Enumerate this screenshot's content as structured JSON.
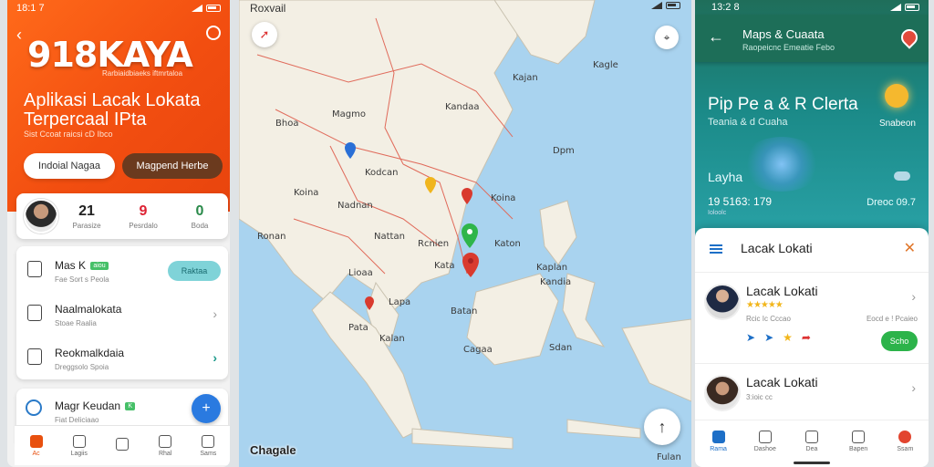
{
  "left": {
    "status_time": "18:1 7",
    "brand": "918KAYA",
    "brand_sub": "Rarbiaidbiaeks iftmrtaloa",
    "title": "Aplikasi Lacak Lokata Terpercaal IPta",
    "small": "Sist Ccoat raicsi cD Ibco",
    "btn_primary": "Indoial Nagaa",
    "btn_secondary": "Magpend Herbe",
    "stats": [
      {
        "value": "21",
        "label": "Parasize"
      },
      {
        "value": "9",
        "label": "Pesrdalo"
      },
      {
        "value": "0",
        "label": "Boda"
      }
    ],
    "list": [
      {
        "title": "Mas K",
        "tag": "aiou",
        "sub": "Fae Sort s Peola",
        "pill": "Raktaa"
      },
      {
        "title": "Naalmalokata",
        "sub": "Stoae Raalia"
      },
      {
        "title": "Reokmalkdaia",
        "sub": "Dreggsolo Spoia"
      }
    ],
    "card2": {
      "title": "Magr Keudan",
      "tag": "K",
      "sub": "Fiat Deliciaao"
    },
    "nav": [
      "Ac",
      "Lagiis",
      "",
      "Rhal",
      "Sams"
    ]
  },
  "map": {
    "title": "Roxvail",
    "logo": "Chagale",
    "labels": [
      {
        "text": "Kajan",
        "cls": "l1"
      },
      {
        "text": "Kagle",
        "cls": "l2"
      },
      {
        "text": "Bhoa",
        "cls": "l3"
      },
      {
        "text": "Magmo",
        "cls": "l4"
      },
      {
        "text": "Kandaa",
        "cls": "l5"
      },
      {
        "text": "Koina",
        "cls": "l6"
      },
      {
        "text": "Dpm",
        "cls": "l7"
      },
      {
        "text": "Kodcan",
        "cls": "l8"
      },
      {
        "text": "Koina",
        "cls": "l9"
      },
      {
        "text": "Nadnan",
        "cls": "l10"
      },
      {
        "text": "Nattan",
        "cls": "l11"
      },
      {
        "text": "Ronan",
        "cls": "l12"
      },
      {
        "text": "Rcnien",
        "cls": "l13"
      },
      {
        "text": "Katon",
        "cls": "l14"
      },
      {
        "text": "Kaplan",
        "cls": "l15"
      },
      {
        "text": "Lioaa",
        "cls": "l16"
      },
      {
        "text": "Kata",
        "cls": "l17"
      },
      {
        "text": "Pata",
        "cls": "l18"
      },
      {
        "text": "Batan",
        "cls": "l19"
      },
      {
        "text": "Cagaa",
        "cls": "l20"
      },
      {
        "text": "Kalan",
        "cls": "l21"
      },
      {
        "text": "Kandia",
        "cls": "l22"
      },
      {
        "text": "Lapa",
        "cls": "l23"
      },
      {
        "text": "Fulan",
        "cls": "l24"
      },
      {
        "text": "Sdan",
        "cls": "l25"
      }
    ]
  },
  "right": {
    "status_time": "13:2 8",
    "topbar_title": "Maps & Cuaata",
    "topbar_sub": "Raopeicnc Emeatie Febo",
    "hero_title": "Pip Pe a & R Clerta",
    "hero_sub": "Teania & d Cuaha",
    "sun_label": "Snabeon",
    "layer": "Layha",
    "coord1": "19 5163: 179",
    "coord1_sub": "Ioloolc",
    "coord2": "Dreoc 09.7",
    "sheet_title": "Lacak Lokati",
    "item1_name": "Lacak Lokati",
    "item1_stars": "★★★★★",
    "item1_sub": "Rcic Ic Cccao",
    "item1_right": "Eocd e ! Pcaieo",
    "item1_btn": "Scho",
    "item2_name": "Lacak Lokati",
    "item2_sub": "3:ioic cc",
    "nav": [
      "Rama",
      "Dashoe",
      "Dea",
      "Bapen",
      "Ssam"
    ]
  }
}
